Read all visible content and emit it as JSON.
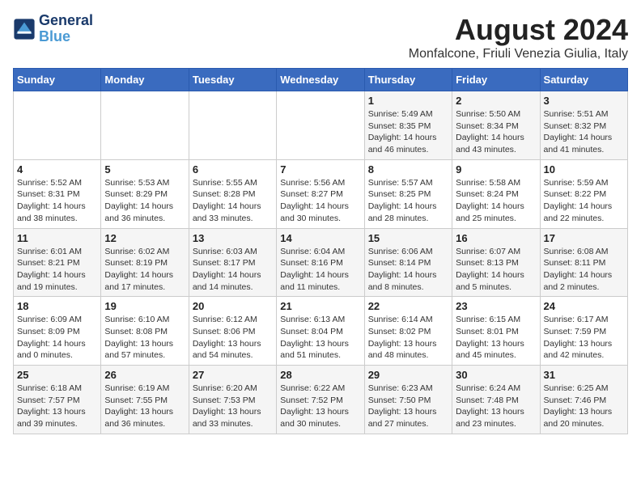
{
  "logo": {
    "line1": "General",
    "line2": "Blue"
  },
  "title": "August 2024",
  "location": "Monfalcone, Friuli Venezia Giulia, Italy",
  "headers": [
    "Sunday",
    "Monday",
    "Tuesday",
    "Wednesday",
    "Thursday",
    "Friday",
    "Saturday"
  ],
  "weeks": [
    [
      {
        "day": "",
        "info": ""
      },
      {
        "day": "",
        "info": ""
      },
      {
        "day": "",
        "info": ""
      },
      {
        "day": "",
        "info": ""
      },
      {
        "day": "1",
        "info": "Sunrise: 5:49 AM\nSunset: 8:35 PM\nDaylight: 14 hours and 46 minutes."
      },
      {
        "day": "2",
        "info": "Sunrise: 5:50 AM\nSunset: 8:34 PM\nDaylight: 14 hours and 43 minutes."
      },
      {
        "day": "3",
        "info": "Sunrise: 5:51 AM\nSunset: 8:32 PM\nDaylight: 14 hours and 41 minutes."
      }
    ],
    [
      {
        "day": "4",
        "info": "Sunrise: 5:52 AM\nSunset: 8:31 PM\nDaylight: 14 hours and 38 minutes."
      },
      {
        "day": "5",
        "info": "Sunrise: 5:53 AM\nSunset: 8:29 PM\nDaylight: 14 hours and 36 minutes."
      },
      {
        "day": "6",
        "info": "Sunrise: 5:55 AM\nSunset: 8:28 PM\nDaylight: 14 hours and 33 minutes."
      },
      {
        "day": "7",
        "info": "Sunrise: 5:56 AM\nSunset: 8:27 PM\nDaylight: 14 hours and 30 minutes."
      },
      {
        "day": "8",
        "info": "Sunrise: 5:57 AM\nSunset: 8:25 PM\nDaylight: 14 hours and 28 minutes."
      },
      {
        "day": "9",
        "info": "Sunrise: 5:58 AM\nSunset: 8:24 PM\nDaylight: 14 hours and 25 minutes."
      },
      {
        "day": "10",
        "info": "Sunrise: 5:59 AM\nSunset: 8:22 PM\nDaylight: 14 hours and 22 minutes."
      }
    ],
    [
      {
        "day": "11",
        "info": "Sunrise: 6:01 AM\nSunset: 8:21 PM\nDaylight: 14 hours and 19 minutes."
      },
      {
        "day": "12",
        "info": "Sunrise: 6:02 AM\nSunset: 8:19 PM\nDaylight: 14 hours and 17 minutes."
      },
      {
        "day": "13",
        "info": "Sunrise: 6:03 AM\nSunset: 8:17 PM\nDaylight: 14 hours and 14 minutes."
      },
      {
        "day": "14",
        "info": "Sunrise: 6:04 AM\nSunset: 8:16 PM\nDaylight: 14 hours and 11 minutes."
      },
      {
        "day": "15",
        "info": "Sunrise: 6:06 AM\nSunset: 8:14 PM\nDaylight: 14 hours and 8 minutes."
      },
      {
        "day": "16",
        "info": "Sunrise: 6:07 AM\nSunset: 8:13 PM\nDaylight: 14 hours and 5 minutes."
      },
      {
        "day": "17",
        "info": "Sunrise: 6:08 AM\nSunset: 8:11 PM\nDaylight: 14 hours and 2 minutes."
      }
    ],
    [
      {
        "day": "18",
        "info": "Sunrise: 6:09 AM\nSunset: 8:09 PM\nDaylight: 14 hours and 0 minutes."
      },
      {
        "day": "19",
        "info": "Sunrise: 6:10 AM\nSunset: 8:08 PM\nDaylight: 13 hours and 57 minutes."
      },
      {
        "day": "20",
        "info": "Sunrise: 6:12 AM\nSunset: 8:06 PM\nDaylight: 13 hours and 54 minutes."
      },
      {
        "day": "21",
        "info": "Sunrise: 6:13 AM\nSunset: 8:04 PM\nDaylight: 13 hours and 51 minutes."
      },
      {
        "day": "22",
        "info": "Sunrise: 6:14 AM\nSunset: 8:02 PM\nDaylight: 13 hours and 48 minutes."
      },
      {
        "day": "23",
        "info": "Sunrise: 6:15 AM\nSunset: 8:01 PM\nDaylight: 13 hours and 45 minutes."
      },
      {
        "day": "24",
        "info": "Sunrise: 6:17 AM\nSunset: 7:59 PM\nDaylight: 13 hours and 42 minutes."
      }
    ],
    [
      {
        "day": "25",
        "info": "Sunrise: 6:18 AM\nSunset: 7:57 PM\nDaylight: 13 hours and 39 minutes."
      },
      {
        "day": "26",
        "info": "Sunrise: 6:19 AM\nSunset: 7:55 PM\nDaylight: 13 hours and 36 minutes."
      },
      {
        "day": "27",
        "info": "Sunrise: 6:20 AM\nSunset: 7:53 PM\nDaylight: 13 hours and 33 minutes."
      },
      {
        "day": "28",
        "info": "Sunrise: 6:22 AM\nSunset: 7:52 PM\nDaylight: 13 hours and 30 minutes."
      },
      {
        "day": "29",
        "info": "Sunrise: 6:23 AM\nSunset: 7:50 PM\nDaylight: 13 hours and 27 minutes."
      },
      {
        "day": "30",
        "info": "Sunrise: 6:24 AM\nSunset: 7:48 PM\nDaylight: 13 hours and 23 minutes."
      },
      {
        "day": "31",
        "info": "Sunrise: 6:25 AM\nSunset: 7:46 PM\nDaylight: 13 hours and 20 minutes."
      }
    ]
  ]
}
